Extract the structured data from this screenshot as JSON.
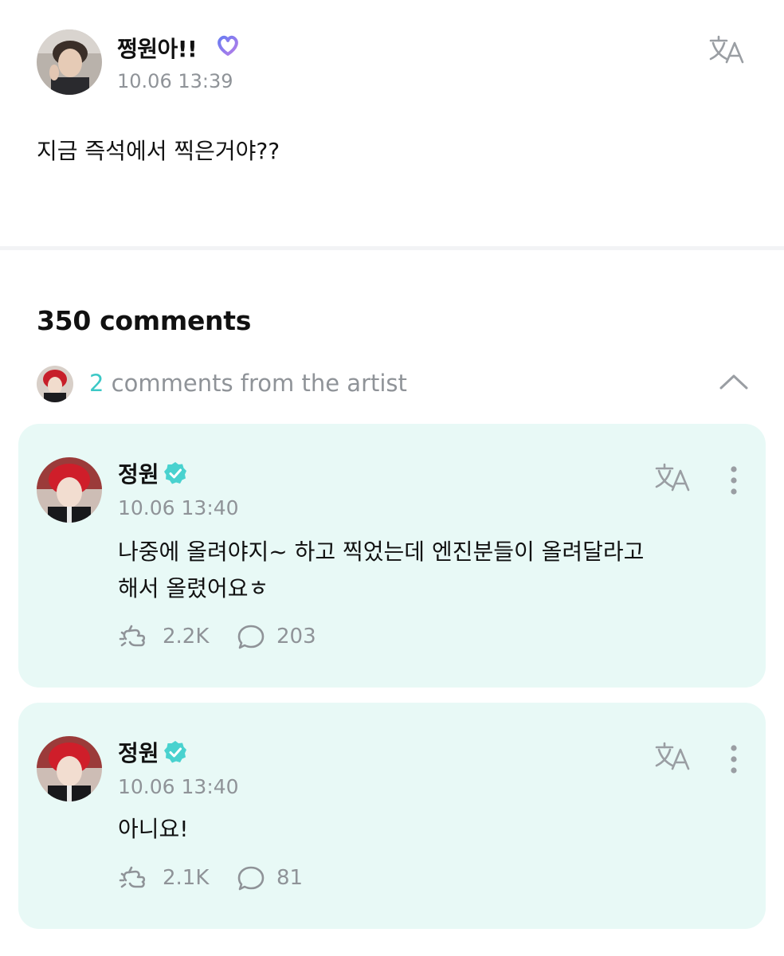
{
  "post": {
    "author": "쩡원아!!",
    "time": "10.06 13:39",
    "body": "지금 즉석에서 찍은거야??"
  },
  "comments_header": {
    "title": "350 comments",
    "artist_count": "2",
    "artist_label": "comments from the artist"
  },
  "comments": [
    {
      "name": "정원",
      "time": "10.06 13:40",
      "text_line1": "나중에 올려야지~ 하고 찍었는데 엔진분들이 올려달라고",
      "text_line2": "해서 올렸어요ㅎ",
      "likes": "2.2K",
      "replies": "203"
    },
    {
      "name": "정원",
      "time": "10.06 13:40",
      "text_line1": "아니요!",
      "likes": "2.1K",
      "replies": "81"
    }
  ],
  "colors": {
    "accent_teal": "#3cc8c6",
    "artist_card_bg": "#e8f9f6",
    "muted_text": "#8f9398",
    "verified_badge": "#49d2cf"
  },
  "icons": [
    "heart-badge-icon",
    "translate-icon",
    "chevron-up-icon",
    "verified-badge-icon",
    "more-options-icon",
    "cheer-icon",
    "reply-bubble-icon"
  ]
}
